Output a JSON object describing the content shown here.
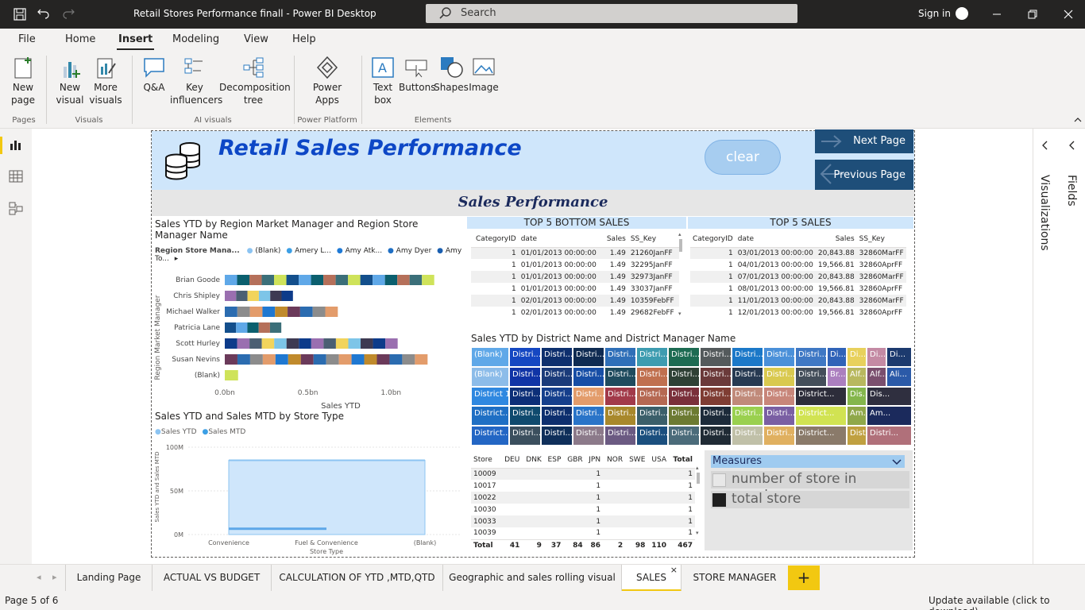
{
  "window": {
    "title": "Retail Stores Performance finall - Power BI Desktop",
    "search_placeholder": "Search",
    "sign_in": "Sign in"
  },
  "ribbon_tabs": [
    "File",
    "Home",
    "Insert",
    "Modeling",
    "View",
    "Help"
  ],
  "ribbon": {
    "new_page": "New page",
    "new_visual": "New visual",
    "more_visuals": "More visuals",
    "qa": "Q&A",
    "key_influencers": "Key influencers",
    "decomposition_tree": "Decomposition tree",
    "power_apps": "Power Apps",
    "text_box": "Text box",
    "buttons": "Buttons",
    "shapes": "Shapes",
    "image": "Image",
    "groups": {
      "pages": "Pages",
      "visuals": "Visuals",
      "ai_visuals": "AI visuals",
      "power_platform": "Power Platform",
      "elements": "Elements"
    }
  },
  "report": {
    "title": "Retail Sales Performance",
    "clear_label": "clear",
    "next_page": "Next Page",
    "previous_page": "Previous Page",
    "section_title": "Sales  Performance",
    "bar_visual": {
      "title": "Sales YTD by Region Market Manager and Region Store Manager Name",
      "legend_title": "Region Store Mana...",
      "legend_items": [
        "(Blank)",
        "Amery L...",
        "Amy Atk...",
        "Amy Dyer",
        "Amy To..."
      ],
      "y_axis_title": "Region Market Manager",
      "x_axis_title": "Sales YTD"
    },
    "combo_visual": {
      "title": "Sales YTD and Sales MTD by Store Type",
      "legend": [
        "Sales YTD",
        "Sales MTD"
      ],
      "y_axis_title": "Sales YTD and Sales MTD",
      "x_axis_title": "Store Type"
    },
    "bottom5": {
      "title": "TOP 5 BOTTOM SALES",
      "columns": [
        "CategoryID",
        "date",
        "Sales",
        "SS_Key"
      ],
      "rows": [
        [
          "1",
          "01/01/2013 00:00:00",
          "1.49",
          "21260JanFF"
        ],
        [
          "1",
          "01/01/2013 00:00:00",
          "1.49",
          "32295JanFF"
        ],
        [
          "1",
          "01/01/2013 00:00:00",
          "1.49",
          "32973JanFF"
        ],
        [
          "1",
          "01/01/2013 00:00:00",
          "1.49",
          "33037JanFF"
        ],
        [
          "1",
          "02/01/2013 00:00:00",
          "1.49",
          "10359FebFF"
        ],
        [
          "1",
          "02/01/2013 00:00:00",
          "1.49",
          "29682FebFF"
        ]
      ]
    },
    "top5": {
      "title": "TOP 5 SALES",
      "columns": [
        "CategoryID",
        "date",
        "Sales",
        "SS_Key"
      ],
      "rows": [
        [
          "1",
          "03/01/2013 00:00:00",
          "20,843.88",
          "32860MarFF"
        ],
        [
          "1",
          "04/01/2013 00:00:00",
          "19,566.81",
          "32860AprFF"
        ],
        [
          "1",
          "07/01/2013 00:00:00",
          "20,843.88",
          "32860MarFF"
        ],
        [
          "1",
          "08/01/2013 00:00:00",
          "19,566.81",
          "32860AprFF"
        ],
        [
          "1",
          "11/01/2013 00:00:00",
          "20,843.88",
          "32860MarFF"
        ],
        [
          "1",
          "12/01/2013 00:00:00",
          "19,566.81",
          "32860AprFF"
        ]
      ]
    },
    "treemap": {
      "title": "Sales YTD by District Name and District Manager Name"
    },
    "matrix": {
      "columns": [
        "Store",
        "DEU",
        "DNK",
        "ESP",
        "GBR",
        "JPN",
        "NOR",
        "SWE",
        "USA",
        "Total"
      ],
      "rows": [
        [
          "10009",
          "",
          "",
          "",
          "",
          "1",
          "",
          "",
          "",
          "1"
        ],
        [
          "10017",
          "",
          "",
          "",
          "",
          "1",
          "",
          "",
          "",
          "1"
        ],
        [
          "10022",
          "",
          "",
          "",
          "",
          "1",
          "",
          "",
          "",
          "1"
        ],
        [
          "10030",
          "",
          "",
          "",
          "",
          "1",
          "",
          "",
          "",
          "1"
        ],
        [
          "10033",
          "",
          "",
          "",
          "",
          "1",
          "",
          "",
          "",
          "1"
        ],
        [
          "10039",
          "",
          "",
          "",
          "",
          "1",
          "",
          "",
          "",
          "1"
        ]
      ],
      "total_row": [
        "Total",
        "41",
        "9",
        "37",
        "84",
        "86",
        "2",
        "98",
        "110",
        "467"
      ]
    },
    "measures": {
      "header": "Measures",
      "options": [
        {
          "label": "number of store in country",
          "checked": false
        },
        {
          "label": "total store",
          "checked": true
        }
      ]
    }
  },
  "chart_data": [
    {
      "type": "bar",
      "title": "Sales YTD by Region Market Manager and Region Store Manager Name",
      "categories": [
        "Brian Goode",
        "Chris Shipley",
        "Michael Walker",
        "Patricia Lane",
        "Scott Hurley",
        "Susan Nevins",
        "(Blank)"
      ],
      "values": [
        1.26,
        0.41,
        0.68,
        0.34,
        1.04,
        1.22,
        0.08
      ],
      "xlabel": "Sales YTD",
      "ylabel": "Region Market Manager",
      "x_ticks": [
        "0.0bn",
        "0.5bn",
        "1.0bn"
      ],
      "xlim": [
        0,
        1.4
      ]
    },
    {
      "type": "area",
      "title": "Sales YTD and Sales MTD by Store Type",
      "categories": [
        "Convenience",
        "Fuel & Convenience",
        "(Blank)"
      ],
      "series": [
        {
          "name": "Sales YTD",
          "values": [
            null,
            85,
            85
          ]
        },
        {
          "name": "Sales MTD",
          "values": [
            null,
            8,
            null
          ]
        }
      ],
      "xlabel": "Store Type",
      "ylabel": "Sales YTD and Sales MTD",
      "y_ticks": [
        "0M",
        "50M",
        "100M"
      ],
      "ylim": [
        0,
        100
      ]
    }
  ],
  "page_tabs": [
    "Landing Page",
    "ACTUAL VS BUDGET",
    "CALCULATION OF YTD ,MTD,QTD",
    "Geographic and sales rolling visual",
    "SALES",
    "STORE MANAGER"
  ],
  "active_page_tab": "SALES",
  "status": {
    "page": "Page 5 of 6",
    "update": "Update available (click to download)"
  },
  "right_panes": {
    "visualizations": "Visualizations",
    "fields": "Fields"
  },
  "colors": {
    "accent": "#f2c811",
    "header_bg": "#cfe6fb",
    "title_blue": "#0d47c6",
    "nav_btn": "#1e4e79"
  }
}
